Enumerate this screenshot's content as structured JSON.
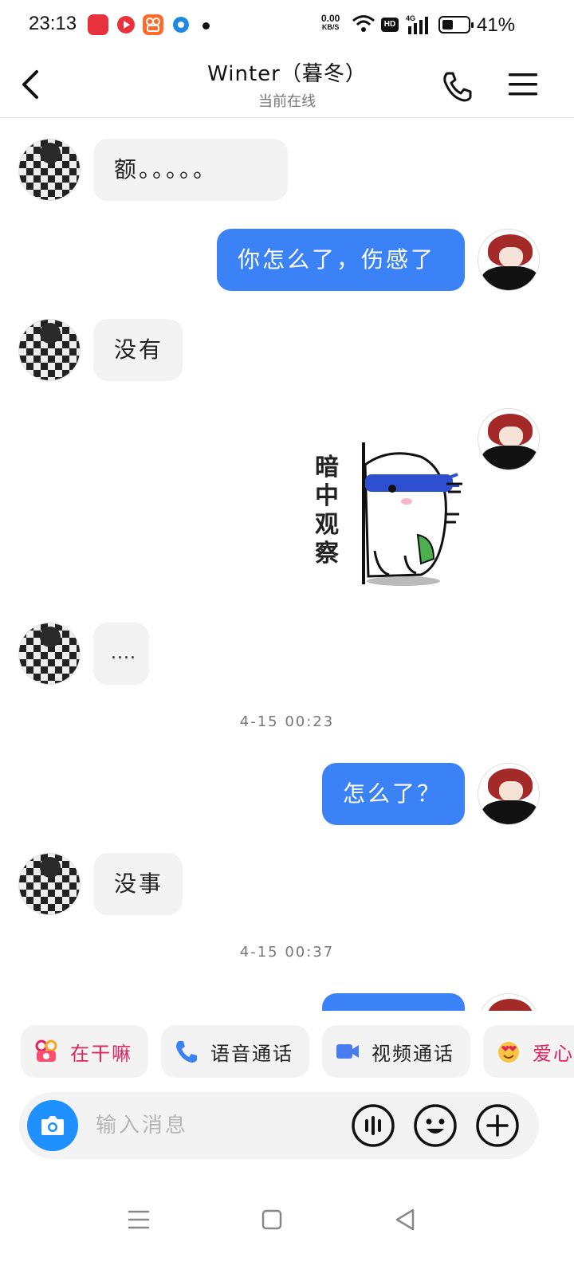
{
  "status_bar": {
    "time": "23:13",
    "net_speed_value": "0.00",
    "net_speed_unit": "KB/S",
    "hd_label": "HD",
    "network_type": "4G",
    "battery_percent": "41%",
    "battery_level": 0.41
  },
  "header": {
    "title": "Winter（暮冬）",
    "subtitle": "当前在线"
  },
  "messages": {
    "m1": "额。。。。。",
    "m2": "你怎么了，伤感了",
    "m3": "没有",
    "sticker_text": "暗中观察",
    "m5": "....",
    "ts1": "4-15 00:23",
    "m6": "怎么了？",
    "m7": "没事",
    "ts2": "4-15 00:37"
  },
  "quick_actions": {
    "what_doing": "在干嘛",
    "voice_call": "语音通话",
    "video_call": "视频通话",
    "love": "爱心"
  },
  "input": {
    "placeholder": "输入消息",
    "value": ""
  },
  "colors": {
    "accent_blue": "#3b82f6",
    "bubble_gray": "#f3f3f3",
    "camera_blue": "#1e90ff",
    "chip_pink": "#e0245e"
  }
}
